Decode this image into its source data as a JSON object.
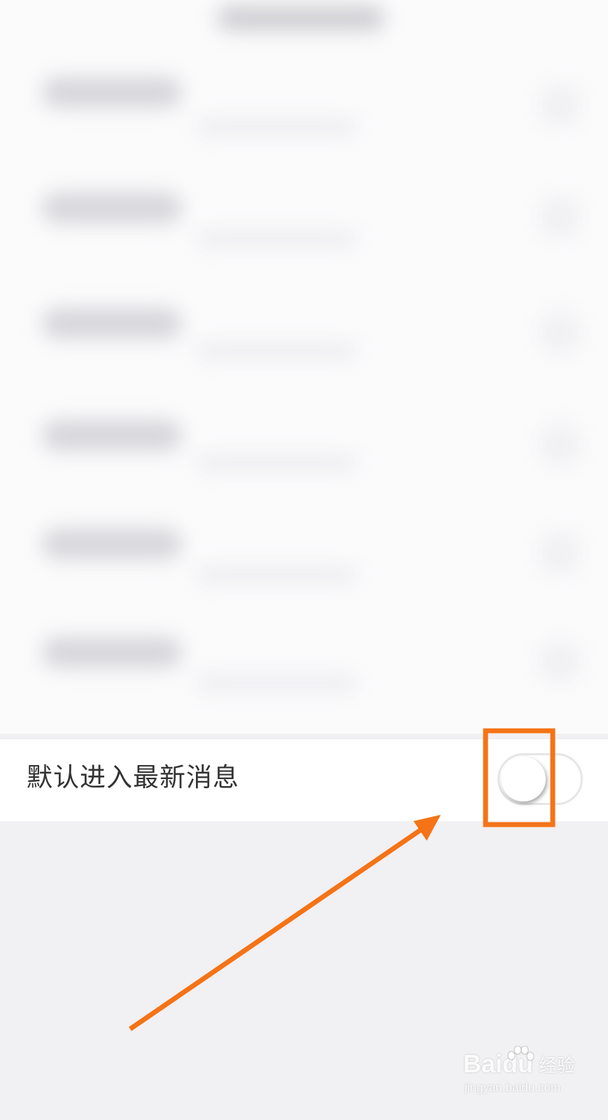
{
  "setting": {
    "label": "默认进入最新消息",
    "toggle_on": false
  },
  "annotation": {
    "color": "#f57316"
  },
  "watermark": {
    "brand": "Baidu",
    "brand_cn": "经验",
    "url": "jingyan.baidu.com"
  },
  "icons": [
    "toggle-switch-icon",
    "arrow-annotation-icon",
    "paw-icon"
  ]
}
